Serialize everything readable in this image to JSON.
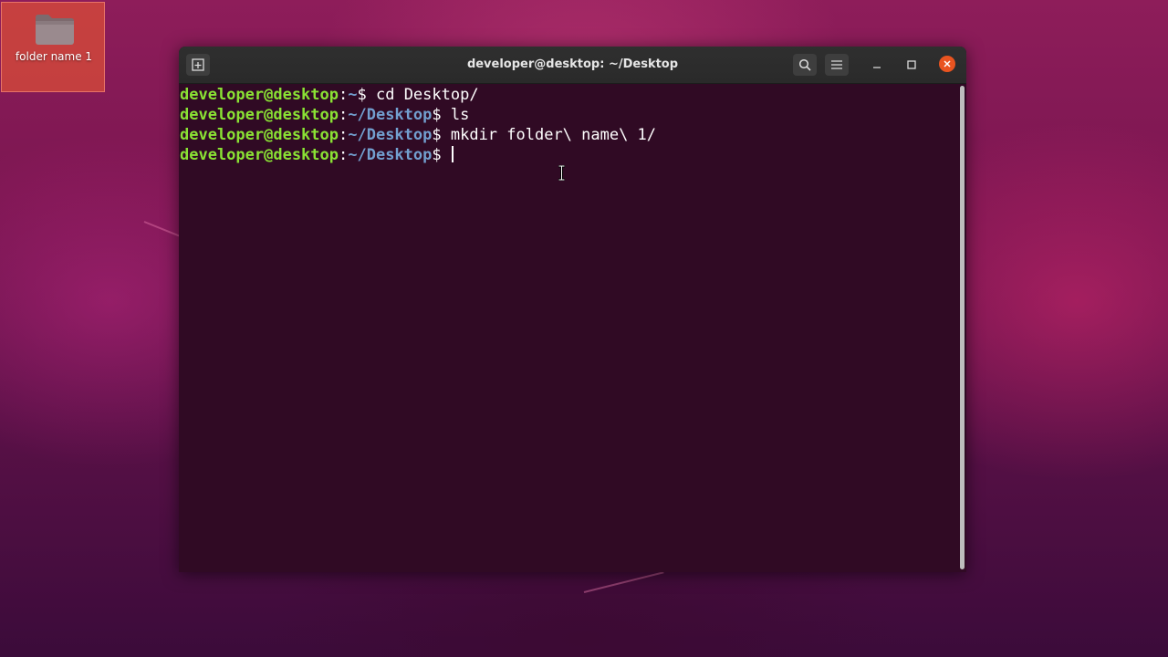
{
  "desktop": {
    "icons": [
      {
        "label": "folder name 1",
        "icon": "folder-icon"
      }
    ],
    "colors": {
      "wallpaper_top": "#8e1d5a",
      "wallpaper_bottom": "#3b0b3a",
      "icon_selection": "#d64a38"
    }
  },
  "terminal": {
    "title": "developer@desktop: ~/Desktop",
    "titlebar_icons": [
      "new-tab-icon",
      "search-icon",
      "hamburger-menu-icon",
      "minimize-icon",
      "maximize-icon",
      "close-icon"
    ],
    "colors": {
      "background": "#300a24",
      "titlebar": "#2c2c2c",
      "prompt_user": "#8ae234",
      "prompt_path": "#729fcf",
      "close_button": "#e95420"
    },
    "lines": [
      {
        "user": "developer@desktop",
        "colon": ":",
        "path": "~",
        "dollar": "$",
        "command": " cd Desktop/"
      },
      {
        "user": "developer@desktop",
        "colon": ":",
        "path": "~/Desktop",
        "dollar": "$",
        "command": " ls"
      },
      {
        "user": "developer@desktop",
        "colon": ":",
        "path": "~/Desktop",
        "dollar": "$",
        "command": " mkdir folder\\ name\\ 1/"
      },
      {
        "user": "developer@desktop",
        "colon": ":",
        "path": "~/Desktop",
        "dollar": "$",
        "command": " "
      }
    ]
  }
}
